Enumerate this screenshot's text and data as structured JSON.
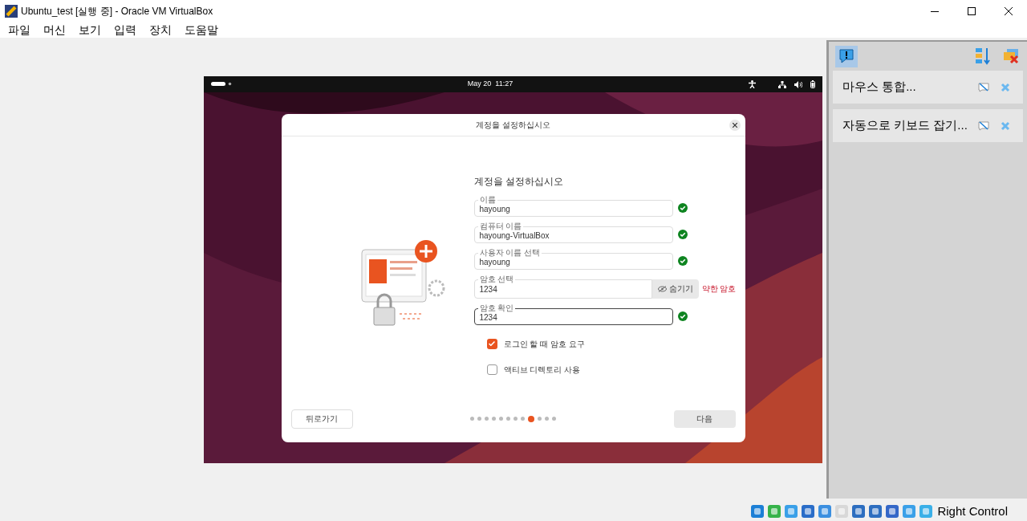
{
  "window": {
    "title": "Ubuntu_test [실행 중] - Oracle VM VirtualBox"
  },
  "menu": [
    "파일",
    "머신",
    "보기",
    "입력",
    "장치",
    "도움말"
  ],
  "guest_topbar": {
    "clock": "May 20  11:27"
  },
  "dialog": {
    "title": "계정을 설정하십시오",
    "heading": "계정을 설정하십시오",
    "fields": [
      {
        "kind": "text",
        "label": "이름",
        "value": "hayoung",
        "valid": true,
        "focused": false
      },
      {
        "kind": "text",
        "label": "컴퓨터 이름",
        "value": "hayoung-VirtualBox",
        "valid": true,
        "focused": false
      },
      {
        "kind": "text",
        "label": "사용자 이름 선택",
        "value": "hayoung",
        "valid": true,
        "focused": false
      },
      {
        "kind": "password",
        "label": "암호 선택",
        "value": "1234",
        "valid": false,
        "focused": false,
        "toggle": "숨기기",
        "strength": "약한 암호"
      },
      {
        "kind": "text",
        "label": "암호 확인",
        "value": "1234",
        "valid": true,
        "focused": true
      }
    ],
    "options": [
      {
        "label": "로그인 할 때 암호 요구",
        "checked": true
      },
      {
        "label": "액티브 디렉토리 사용",
        "checked": false
      }
    ],
    "back": "뒤로가기",
    "next": "다음",
    "steps": [
      {
        "selected": false
      },
      {
        "selected": false
      },
      {
        "selected": false
      },
      {
        "selected": false
      },
      {
        "selected": false
      },
      {
        "selected": false
      },
      {
        "selected": false
      },
      {
        "selected": false
      },
      {
        "selected": true
      },
      {
        "selected": false
      },
      {
        "selected": false
      },
      {
        "selected": false
      }
    ]
  },
  "notifications": [
    {
      "text": "마우스 통합..."
    },
    {
      "text": "자동으로 키보드 잡기..."
    }
  ],
  "status_bar": {
    "host_key": "Right Control"
  }
}
